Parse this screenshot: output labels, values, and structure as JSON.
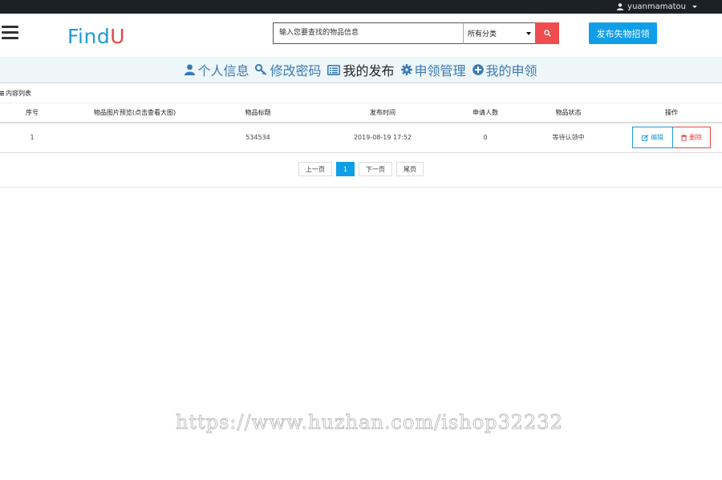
{
  "topbar": {
    "username": "yuanmamatou"
  },
  "header": {
    "logo_part1": "Find",
    "logo_part2": "U",
    "search_placeholder": "输入您要查找的物品信息",
    "category_selected": "所有分类",
    "publish_label": "发布失物招领"
  },
  "nav": {
    "items": [
      {
        "label": "个人信息",
        "icon": "user-icon"
      },
      {
        "label": "修改密码",
        "icon": "key-icon"
      },
      {
        "label": "我的发布",
        "icon": "list-card-icon"
      },
      {
        "label": "申领管理",
        "icon": "gear-icon"
      },
      {
        "label": "我的申领",
        "icon": "plus-circle-icon"
      }
    ]
  },
  "list": {
    "title": "内容列表",
    "columns": [
      "序号",
      "物品图片预览(点击查看大图)",
      "物品标题",
      "发布时间",
      "申请人数",
      "物品状态",
      "操作"
    ],
    "rows": [
      {
        "index": "1",
        "image": "",
        "title": "534534",
        "time": "2019-08-19 17:52",
        "applicants": "0",
        "status": "等待认领中"
      }
    ],
    "edit_label": "编辑",
    "delete_label": "删除"
  },
  "pager": {
    "prev": "上一页",
    "current": "1",
    "next": "下一页",
    "last": "尾页"
  },
  "watermark": "https://www.huzhan.com/ishop32232",
  "colors": {
    "topbar": "#1c2126",
    "accent": "#109ee8",
    "danger": "#e54747",
    "nav_bg": "#eef6fa"
  }
}
